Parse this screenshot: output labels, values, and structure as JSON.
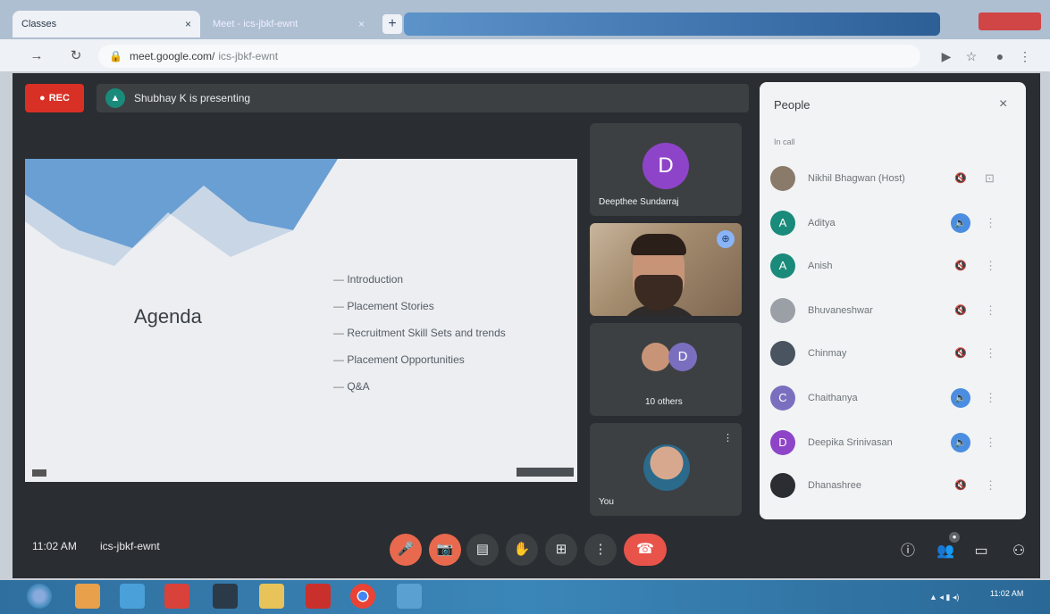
{
  "browser": {
    "tabs": [
      {
        "label": "Classes"
      },
      {
        "label": "Meet - ics-jbkf-ewnt"
      }
    ],
    "new_tab": "+",
    "url": "meet.google.com/",
    "url_path": "ics-jbkf-ewnt"
  },
  "meet": {
    "rec_label": "REC",
    "presenting_text": "Shubhay K is presenting",
    "slide": {
      "title": "Agenda",
      "items": [
        "Introduction",
        "Placement Stories",
        "Recruitment Skill Sets and trends",
        "Placement Opportunities",
        "Q&A"
      ]
    },
    "tiles": [
      {
        "name": "Deepthee Sundarraj",
        "initial": "D",
        "color": "#8e44c8"
      },
      {
        "name": "",
        "pin": "⊕"
      },
      {
        "name": "10 others",
        "initial": "D"
      },
      {
        "name": "You"
      }
    ],
    "panel": {
      "title": "People",
      "subtitle": "In call",
      "close": "×",
      "rows": [
        {
          "name": "Nikhil Bhagwan (Host)",
          "initial": "",
          "color": "#8a7a6a",
          "mic": "🔇",
          "active": false
        },
        {
          "name": "Aditya",
          "initial": "A",
          "color": "#1a8a7a",
          "mic": "🔈",
          "active": true
        },
        {
          "name": "Anish",
          "initial": "A",
          "color": "#1a8a7a",
          "mic": "🔇",
          "active": false
        },
        {
          "name": "Bhuvaneshwar",
          "initial": "",
          "color": "#9aa0a6",
          "mic": "🔇",
          "active": false
        },
        {
          "name": "Chinmay",
          "initial": "",
          "color": "#4a5460",
          "mic": "🔇",
          "active": false
        },
        {
          "name": "Chaithanya",
          "initial": "C",
          "color": "#7a6fbf",
          "mic": "🔈",
          "active": true
        },
        {
          "name": "Deepika Srinivasan",
          "initial": "D",
          "color": "#8e44c8",
          "mic": "🔈",
          "active": true
        },
        {
          "name": "Dhanashree",
          "initial": "",
          "color": "#2a2d31",
          "mic": "🔇",
          "active": false
        }
      ]
    },
    "bottom": {
      "time": "11:02 AM",
      "code": "ics-jbkf-ewnt"
    }
  },
  "taskbar": {
    "clock_time": "11:02 AM"
  }
}
